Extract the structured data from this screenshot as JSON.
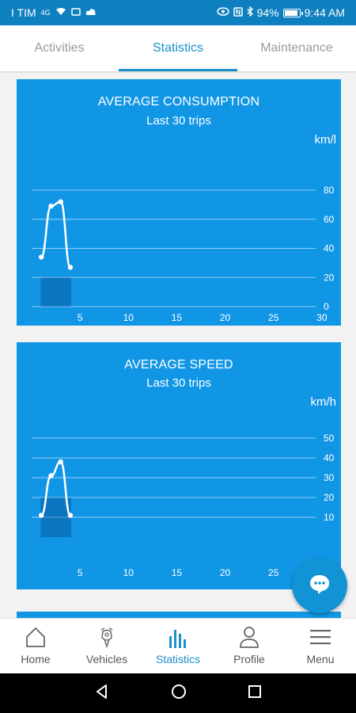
{
  "status_bar": {
    "carrier": "I TIM",
    "network": "4G",
    "battery_percent": "94%",
    "battery_level": 0.94,
    "time": "9:44 AM"
  },
  "tabs": [
    {
      "label": "Activities",
      "active": false
    },
    {
      "label": "Statistics",
      "active": true
    },
    {
      "label": "Maintenance",
      "active": false
    }
  ],
  "cards": [
    {
      "title": "AVERAGE CONSUMPTION",
      "subtitle": "Last 30 trips",
      "unit": "km/l"
    },
    {
      "title": "AVERAGE SPEED",
      "subtitle": "Last 30 trips",
      "unit": "km/h"
    }
  ],
  "chart_data": [
    {
      "type": "line",
      "title": "AVERAGE CONSUMPTION",
      "subtitle": "Last 30 trips",
      "ylabel": "km/l",
      "x": [
        1,
        2,
        3,
        4
      ],
      "values": [
        34,
        69,
        72,
        27
      ],
      "xlim": [
        0,
        32
      ],
      "ylim": [
        0,
        80
      ],
      "xticks": [
        5,
        10,
        15,
        20,
        25,
        30
      ],
      "yticks": [
        0,
        20,
        40,
        60,
        80
      ],
      "grid": true
    },
    {
      "type": "line",
      "title": "AVERAGE SPEED",
      "subtitle": "Last 30 trips",
      "ylabel": "km/h",
      "x": [
        1,
        2,
        3,
        4
      ],
      "values": [
        11,
        31,
        38,
        11
      ],
      "xlim": [
        0,
        32
      ],
      "ylim": [
        0,
        50
      ],
      "xticks": [
        5,
        10,
        15,
        20,
        25
      ],
      "yticks": [
        10,
        20,
        30,
        40,
        50
      ],
      "grid": true
    }
  ],
  "fab": {
    "icon": "chat-bubble-icon"
  },
  "bottom_nav": [
    {
      "label": "Home",
      "icon": "home-icon",
      "active": false
    },
    {
      "label": "Vehicles",
      "icon": "vehicle-icon",
      "active": false
    },
    {
      "label": "Statistics",
      "icon": "bar-chart-icon",
      "active": true
    },
    {
      "label": "Profile",
      "icon": "profile-icon",
      "active": false
    },
    {
      "label": "Menu",
      "icon": "menu-icon",
      "active": false
    }
  ],
  "colors": {
    "primary": "#1b8fc9",
    "card_bg": "#1196e6",
    "status_bar": "#0e7fbf"
  }
}
